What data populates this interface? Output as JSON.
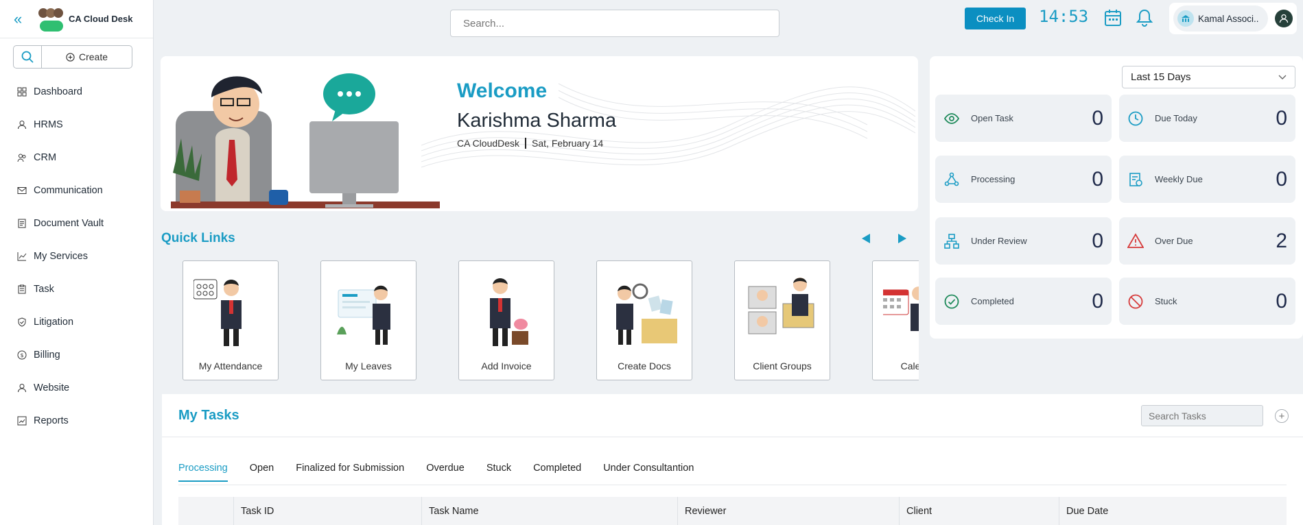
{
  "brand": {
    "name": "CA Cloud Desk"
  },
  "sidebar": {
    "create_label": "Create",
    "items": [
      {
        "label": "Dashboard",
        "icon": "grid-icon"
      },
      {
        "label": "HRMS",
        "icon": "user-icon"
      },
      {
        "label": "CRM",
        "icon": "users-icon"
      },
      {
        "label": "Communication",
        "icon": "mail-icon"
      },
      {
        "label": "Document Vault",
        "icon": "document-icon"
      },
      {
        "label": "My Services",
        "icon": "chart-line-icon"
      },
      {
        "label": "Task",
        "icon": "clipboard-icon"
      },
      {
        "label": "Litigation",
        "icon": "shield-check-icon"
      },
      {
        "label": "Billing",
        "icon": "dollar-circle-icon"
      },
      {
        "label": "Website",
        "icon": "user-icon"
      },
      {
        "label": "Reports",
        "icon": "report-chart-icon"
      }
    ]
  },
  "topbar": {
    "search_placeholder": "Search...",
    "checkin_label": "Check In",
    "clock": "14:53",
    "org_name": "Kamal Associ.."
  },
  "welcome": {
    "title": "Welcome",
    "name": "Karishma Sharma",
    "company": "CA CloudDesk",
    "date": "Sat, February 14"
  },
  "stats": {
    "period": "Last 15 Days",
    "items": [
      {
        "label": "Open Task",
        "value": "0",
        "icon": "eye-icon",
        "color": "#1e8a5a"
      },
      {
        "label": "Due Today",
        "value": "0",
        "icon": "clock-icon",
        "color": "#1a9cc4"
      },
      {
        "label": "Processing",
        "value": "0",
        "icon": "network-icon",
        "color": "#1a9cc4"
      },
      {
        "label": "Weekly Due",
        "value": "0",
        "icon": "calendar-doc-icon",
        "color": "#1a9cc4"
      },
      {
        "label": "Under Review",
        "value": "0",
        "icon": "sitemap-icon",
        "color": "#1a9cc4"
      },
      {
        "label": "Over Due",
        "value": "2",
        "icon": "warning-icon",
        "color": "#d63a3a"
      },
      {
        "label": "Completed",
        "value": "0",
        "icon": "check-circle-icon",
        "color": "#1e8a5a"
      },
      {
        "label": "Stuck",
        "value": "0",
        "icon": "ban-icon",
        "color": "#d63a3a"
      }
    ]
  },
  "quick_links": {
    "title": "Quick Links",
    "items": [
      {
        "label": "My Attendance"
      },
      {
        "label": "My Leaves"
      },
      {
        "label": "Add Invoice"
      },
      {
        "label": "Create Docs"
      },
      {
        "label": "Client Groups"
      },
      {
        "label": "Calendar"
      }
    ]
  },
  "tasks": {
    "title": "My Tasks",
    "search_placeholder": "Search Tasks",
    "tabs": [
      "Processing",
      "Open",
      "Finalized for Submission",
      "Overdue",
      "Stuck",
      "Completed",
      "Under Consultantion"
    ],
    "columns": [
      "Task ID",
      "Task Name",
      "Reviewer",
      "Client",
      "Due Date"
    ]
  }
}
